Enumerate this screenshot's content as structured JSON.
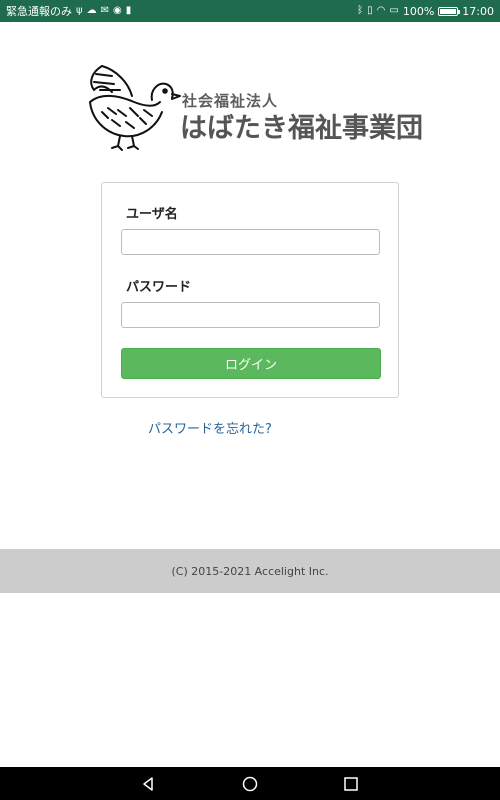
{
  "status_bar": {
    "left_text": "緊急通報のみ",
    "battery_percent": "100%",
    "time": "17:00",
    "battery_level": 1.0
  },
  "logo": {
    "subtitle": "社会福祉法人",
    "name": "はばたき福祉事業団"
  },
  "login": {
    "username_label": "ユーザ名",
    "username_value": "",
    "password_label": "パスワード",
    "password_value": "",
    "login_button": "ログイン",
    "forgot_link": "パスワードを忘れた?"
  },
  "footer": {
    "copyright": "(C) 2015-2021 Accelight Inc."
  },
  "nav_bar": {
    "icons": [
      "back-icon",
      "home-icon",
      "recents-icon"
    ]
  },
  "colors": {
    "status_bar": "#1e6b4e",
    "login_button": "#5cb85c",
    "link": "#2a6496",
    "footer_bg": "#cccccc"
  }
}
